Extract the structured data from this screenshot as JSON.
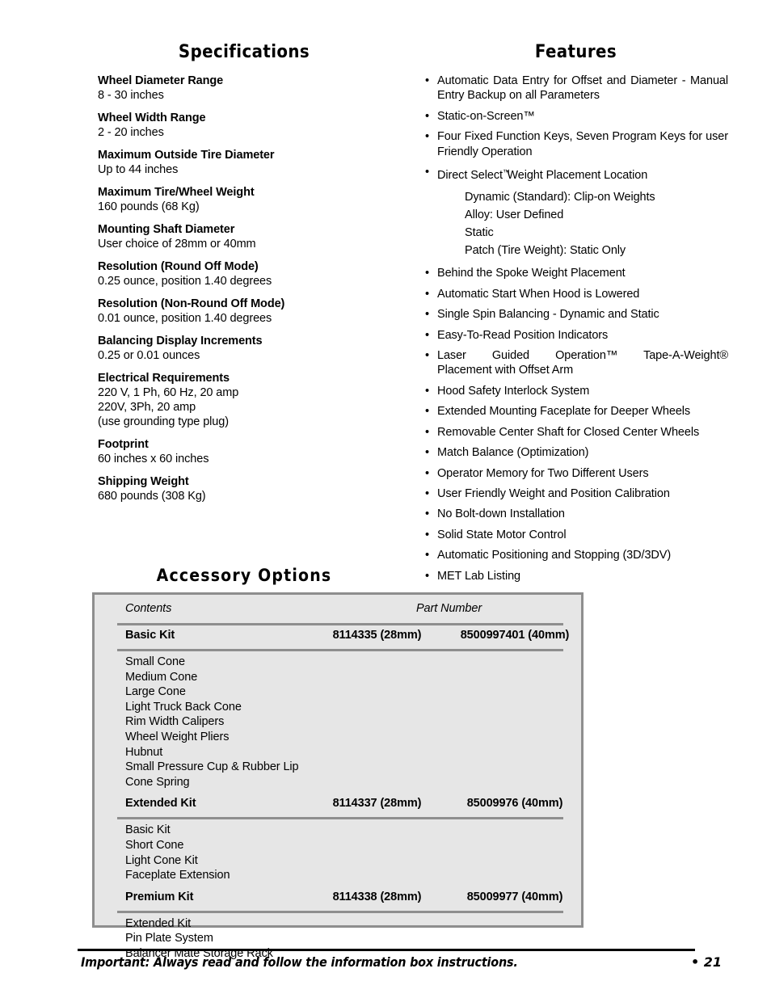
{
  "specifications": {
    "heading": "Specifications",
    "items": [
      {
        "label": "Wheel Diameter Range",
        "value": "8 - 30 inches"
      },
      {
        "label": "Wheel Width Range",
        "value": "2 - 20 inches"
      },
      {
        "label": "Maximum Outside Tire Diameter",
        "value": "Up to 44 inches"
      },
      {
        "label": "Maximum Tire/Wheel Weight",
        "value": "160 pounds (68 Kg)"
      },
      {
        "label": "Mounting Shaft Diameter",
        "value": "User choice of 28mm or 40mm"
      },
      {
        "label": "Resolution (Round Off Mode)",
        "value": "0.25 ounce, position 1.40 degrees"
      },
      {
        "label": "Resolution (Non-Round Off Mode)",
        "value": "0.01 ounce, position 1.40 degrees"
      },
      {
        "label": "Balancing Display Increments",
        "value": "0.25 or 0.01 ounces"
      },
      {
        "label": "Electrical Requirements",
        "value": "220 V, 1 Ph, 60 Hz, 20 amp",
        "value2": "220V, 3Ph, 20 amp",
        "value3": "(use grounding type plug)"
      },
      {
        "label": "Footprint",
        "value": "60 inches x 60 inches"
      },
      {
        "label": "Shipping Weight",
        "value": "680 pounds (308 Kg)"
      }
    ]
  },
  "features": {
    "heading": "Features",
    "items": [
      {
        "text": "Automatic Data Entry for Offset and Diameter - Manual Entry Backup on all Parameters"
      },
      {
        "text": "Static-on-Screen™"
      },
      {
        "text": "Four Fixed Function Keys, Seven Program Keys for user Friendly Operation"
      },
      {
        "text_before_tm": "Direct Select",
        "tm": "™",
        "text_after_tm": "Weight Placement Location"
      },
      {
        "text": "Behind the Spoke Weight Placement"
      },
      {
        "text": "Automatic Start When Hood is Lowered"
      },
      {
        "text": "Single Spin Balancing - Dynamic and Static"
      },
      {
        "text": "Easy-To-Read Position Indicators"
      },
      {
        "justified_part": "Laser Guided Operation™ Tape-A-Weight®",
        "last_line": "Placement with Offset Arm"
      },
      {
        "text": "Hood Safety Interlock System"
      },
      {
        "text": "Extended Mounting Faceplate for Deeper Wheels"
      },
      {
        "text": "Removable Center Shaft for Closed Center Wheels"
      },
      {
        "text": "Match Balance (Optimization)"
      },
      {
        "text": "Operator Memory for Two Different Users"
      },
      {
        "text": "User Friendly Weight and Position Calibration"
      },
      {
        "text": "No Bolt-down Installation"
      },
      {
        "text": "Solid State Motor Control"
      },
      {
        "text": "Automatic Positioning and Stopping (3D/3DV)"
      },
      {
        "text": "MET Lab Listing"
      }
    ],
    "sub_items": [
      "Dynamic (Standard): Clip-on Weights",
      "Alloy: User Defined",
      "Static",
      "Patch (Tire Weight): Static Only"
    ]
  },
  "accessory_options": {
    "heading": "Accessory Options",
    "columns": {
      "contents": "Contents",
      "part_number": "Part Number"
    },
    "kits": [
      {
        "name": "Basic Kit",
        "part_28mm": "8114335 (28mm)",
        "part_40mm": "8500997401 (40mm)",
        "contents": [
          "Small Cone",
          "Medium Cone",
          "Large Cone",
          "Light Truck Back Cone",
          "Rim Width Calipers",
          "Wheel Weight Pliers",
          "Hubnut",
          "Small Pressure Cup & Rubber Lip",
          "Cone Spring"
        ]
      },
      {
        "name": "Extended Kit",
        "part_28mm": "8114337 (28mm)",
        "part_40mm": "85009976 (40mm)",
        "contents": [
          "Basic Kit",
          "Short Cone",
          "Light Cone Kit",
          "Faceplate Extension"
        ]
      },
      {
        "name": "Premium Kit",
        "part_28mm": "8114338 (28mm)",
        "part_40mm": "85009977 (40mm)",
        "contents": [
          "Extended Kit",
          "Pin Plate System",
          "Balancer Mate Storage Rack"
        ]
      }
    ]
  },
  "footer": {
    "note": "Important: Always read and follow the information box instructions.",
    "page": "• 21"
  },
  "colors": {
    "table_background": "#e6e6e6",
    "table_border": "#8e8e8e",
    "rule": "#8e8e8e",
    "text": "#000000",
    "footer_rule": "#000000"
  }
}
